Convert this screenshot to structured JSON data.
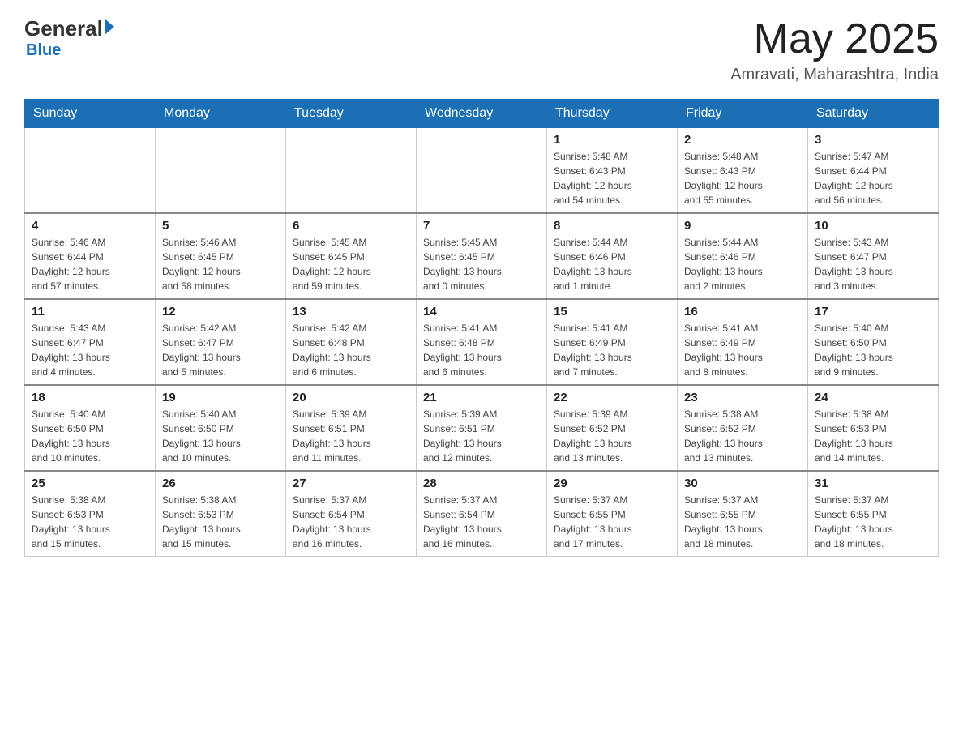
{
  "header": {
    "logo_general": "General",
    "logo_blue": "Blue",
    "month_title": "May 2025",
    "location": "Amravati, Maharashtra, India"
  },
  "weekdays": [
    "Sunday",
    "Monday",
    "Tuesday",
    "Wednesday",
    "Thursday",
    "Friday",
    "Saturday"
  ],
  "weeks": [
    [
      {
        "day": "",
        "info": ""
      },
      {
        "day": "",
        "info": ""
      },
      {
        "day": "",
        "info": ""
      },
      {
        "day": "",
        "info": ""
      },
      {
        "day": "1",
        "info": "Sunrise: 5:48 AM\nSunset: 6:43 PM\nDaylight: 12 hours\nand 54 minutes."
      },
      {
        "day": "2",
        "info": "Sunrise: 5:48 AM\nSunset: 6:43 PM\nDaylight: 12 hours\nand 55 minutes."
      },
      {
        "day": "3",
        "info": "Sunrise: 5:47 AM\nSunset: 6:44 PM\nDaylight: 12 hours\nand 56 minutes."
      }
    ],
    [
      {
        "day": "4",
        "info": "Sunrise: 5:46 AM\nSunset: 6:44 PM\nDaylight: 12 hours\nand 57 minutes."
      },
      {
        "day": "5",
        "info": "Sunrise: 5:46 AM\nSunset: 6:45 PM\nDaylight: 12 hours\nand 58 minutes."
      },
      {
        "day": "6",
        "info": "Sunrise: 5:45 AM\nSunset: 6:45 PM\nDaylight: 12 hours\nand 59 minutes."
      },
      {
        "day": "7",
        "info": "Sunrise: 5:45 AM\nSunset: 6:45 PM\nDaylight: 13 hours\nand 0 minutes."
      },
      {
        "day": "8",
        "info": "Sunrise: 5:44 AM\nSunset: 6:46 PM\nDaylight: 13 hours\nand 1 minute."
      },
      {
        "day": "9",
        "info": "Sunrise: 5:44 AM\nSunset: 6:46 PM\nDaylight: 13 hours\nand 2 minutes."
      },
      {
        "day": "10",
        "info": "Sunrise: 5:43 AM\nSunset: 6:47 PM\nDaylight: 13 hours\nand 3 minutes."
      }
    ],
    [
      {
        "day": "11",
        "info": "Sunrise: 5:43 AM\nSunset: 6:47 PM\nDaylight: 13 hours\nand 4 minutes."
      },
      {
        "day": "12",
        "info": "Sunrise: 5:42 AM\nSunset: 6:47 PM\nDaylight: 13 hours\nand 5 minutes."
      },
      {
        "day": "13",
        "info": "Sunrise: 5:42 AM\nSunset: 6:48 PM\nDaylight: 13 hours\nand 6 minutes."
      },
      {
        "day": "14",
        "info": "Sunrise: 5:41 AM\nSunset: 6:48 PM\nDaylight: 13 hours\nand 6 minutes."
      },
      {
        "day": "15",
        "info": "Sunrise: 5:41 AM\nSunset: 6:49 PM\nDaylight: 13 hours\nand 7 minutes."
      },
      {
        "day": "16",
        "info": "Sunrise: 5:41 AM\nSunset: 6:49 PM\nDaylight: 13 hours\nand 8 minutes."
      },
      {
        "day": "17",
        "info": "Sunrise: 5:40 AM\nSunset: 6:50 PM\nDaylight: 13 hours\nand 9 minutes."
      }
    ],
    [
      {
        "day": "18",
        "info": "Sunrise: 5:40 AM\nSunset: 6:50 PM\nDaylight: 13 hours\nand 10 minutes."
      },
      {
        "day": "19",
        "info": "Sunrise: 5:40 AM\nSunset: 6:50 PM\nDaylight: 13 hours\nand 10 minutes."
      },
      {
        "day": "20",
        "info": "Sunrise: 5:39 AM\nSunset: 6:51 PM\nDaylight: 13 hours\nand 11 minutes."
      },
      {
        "day": "21",
        "info": "Sunrise: 5:39 AM\nSunset: 6:51 PM\nDaylight: 13 hours\nand 12 minutes."
      },
      {
        "day": "22",
        "info": "Sunrise: 5:39 AM\nSunset: 6:52 PM\nDaylight: 13 hours\nand 13 minutes."
      },
      {
        "day": "23",
        "info": "Sunrise: 5:38 AM\nSunset: 6:52 PM\nDaylight: 13 hours\nand 13 minutes."
      },
      {
        "day": "24",
        "info": "Sunrise: 5:38 AM\nSunset: 6:53 PM\nDaylight: 13 hours\nand 14 minutes."
      }
    ],
    [
      {
        "day": "25",
        "info": "Sunrise: 5:38 AM\nSunset: 6:53 PM\nDaylight: 13 hours\nand 15 minutes."
      },
      {
        "day": "26",
        "info": "Sunrise: 5:38 AM\nSunset: 6:53 PM\nDaylight: 13 hours\nand 15 minutes."
      },
      {
        "day": "27",
        "info": "Sunrise: 5:37 AM\nSunset: 6:54 PM\nDaylight: 13 hours\nand 16 minutes."
      },
      {
        "day": "28",
        "info": "Sunrise: 5:37 AM\nSunset: 6:54 PM\nDaylight: 13 hours\nand 16 minutes."
      },
      {
        "day": "29",
        "info": "Sunrise: 5:37 AM\nSunset: 6:55 PM\nDaylight: 13 hours\nand 17 minutes."
      },
      {
        "day": "30",
        "info": "Sunrise: 5:37 AM\nSunset: 6:55 PM\nDaylight: 13 hours\nand 18 minutes."
      },
      {
        "day": "31",
        "info": "Sunrise: 5:37 AM\nSunset: 6:55 PM\nDaylight: 13 hours\nand 18 minutes."
      }
    ]
  ]
}
